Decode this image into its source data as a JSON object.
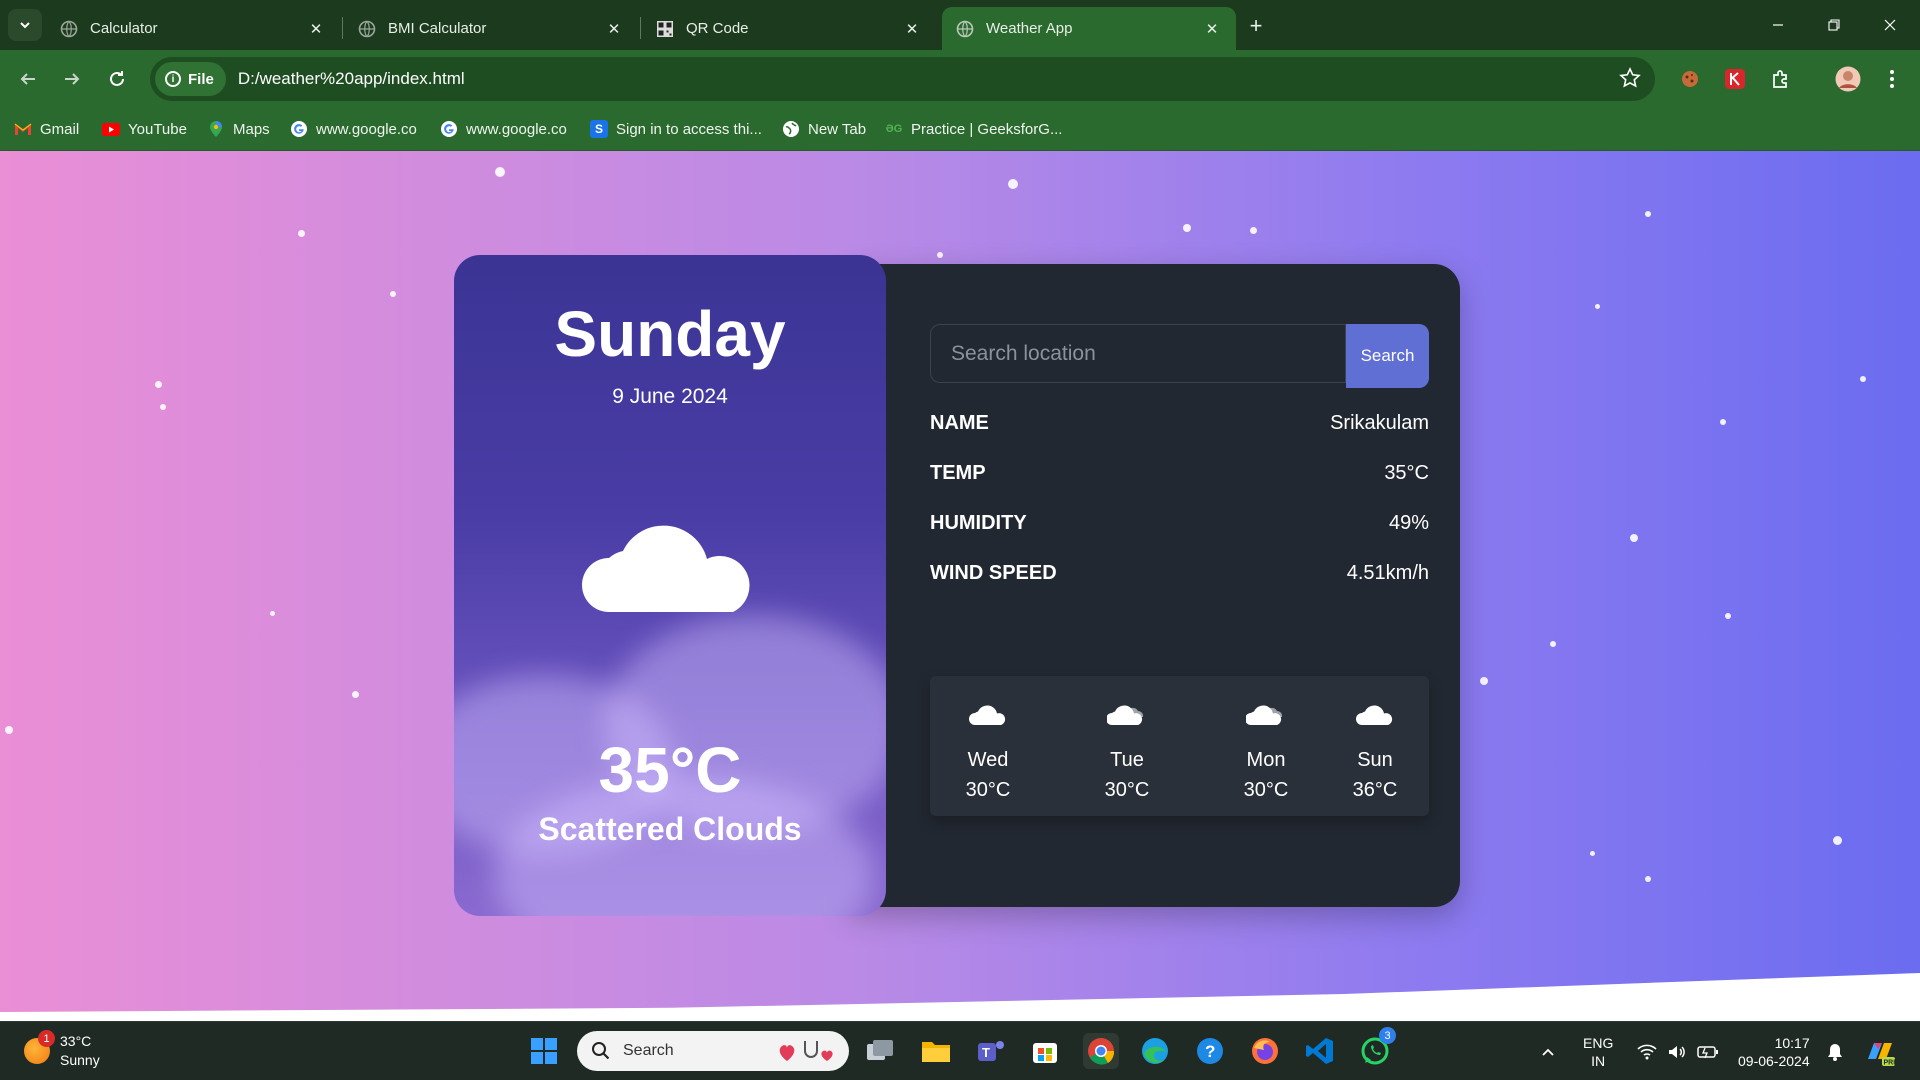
{
  "browser": {
    "tabs": [
      {
        "title": "Calculator",
        "icon": "globe-icon",
        "active": false
      },
      {
        "title": "BMI Calculator",
        "icon": "globe-icon",
        "active": false
      },
      {
        "title": "QR Code",
        "icon": "qr-icon",
        "active": false
      },
      {
        "title": "Weather App",
        "icon": "globe-icon",
        "active": true
      }
    ],
    "address": {
      "scheme_chip": "File",
      "url": "D:/weather%20app/index.html"
    },
    "bookmarks": [
      {
        "label": "Gmail",
        "icon": "gmail-icon"
      },
      {
        "label": "YouTube",
        "icon": "youtube-icon"
      },
      {
        "label": "Maps",
        "icon": "maps-icon"
      },
      {
        "label": "www.google.co",
        "icon": "google-icon"
      },
      {
        "label": "www.google.co",
        "icon": "google-icon"
      },
      {
        "label": "Sign in to access thi...",
        "icon": "s-icon"
      },
      {
        "label": "New Tab",
        "icon": "globe-icon"
      },
      {
        "label": "Practice | GeeksforG...",
        "icon": "gfg-icon"
      }
    ]
  },
  "weather": {
    "day": "Sunday",
    "date": "9 June 2024",
    "temperature": "35°C",
    "description": "Scattered Clouds",
    "search": {
      "placeholder": "Search location",
      "button": "Search"
    },
    "details": [
      {
        "label": "NAME",
        "value": "Srikakulam"
      },
      {
        "label": "TEMP",
        "value": "35°C"
      },
      {
        "label": "HUMIDITY",
        "value": "49%"
      },
      {
        "label": "WIND SPEED",
        "value": "4.51km/h"
      }
    ],
    "forecast": [
      {
        "day": "Wed",
        "temp": "30°C",
        "icon": "cloud-icon"
      },
      {
        "day": "Tue",
        "temp": "30°C",
        "icon": "clouds-icon"
      },
      {
        "day": "Mon",
        "temp": "30°C",
        "icon": "clouds-icon"
      },
      {
        "day": "Sun",
        "temp": "36°C",
        "icon": "cloud-icon"
      }
    ]
  },
  "taskbar": {
    "weather_temp": "33°C",
    "weather_desc": "Sunny",
    "weather_badge": "1",
    "search_label": "Search",
    "whatsapp_badge": "3",
    "lang_top": "ENG",
    "lang_bottom": "IN",
    "time": "10:17",
    "date": "09-06-2024"
  },
  "colors": {
    "chrome_dark": "#1c3a1d",
    "chrome_green": "#2a6a2e",
    "panel": "#222831",
    "accent_button": "#5f6fd4"
  }
}
